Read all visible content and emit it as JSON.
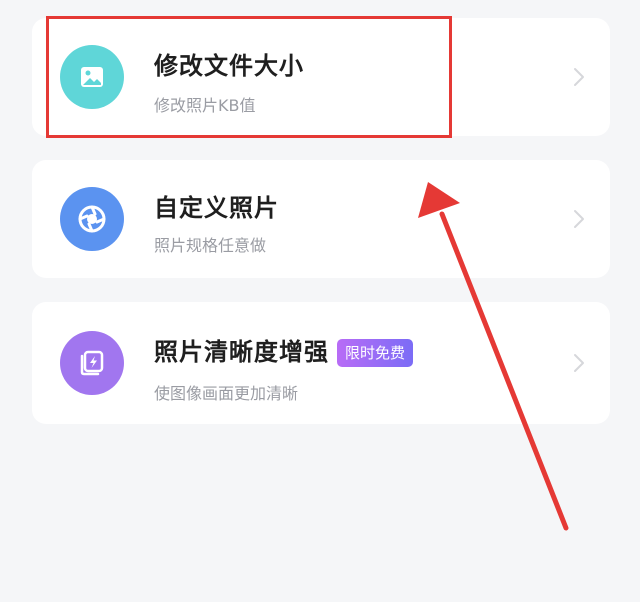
{
  "menu": {
    "items": [
      {
        "title": "修改文件大小",
        "subtitle": "修改照片KB值",
        "icon": "image-icon",
        "icon_color": "#5fd6d8"
      },
      {
        "title": "自定义照片",
        "subtitle": "照片规格任意做",
        "icon": "aperture-icon",
        "icon_color": "#5b93f0"
      },
      {
        "title": "照片清晰度增强",
        "badge": "限时免费",
        "subtitle": "使图像画面更加清晰",
        "icon": "enhance-icon",
        "icon_color": "#a176ef"
      }
    ]
  },
  "annotation": {
    "highlight_color": "#e53935",
    "arrow_color": "#e53935"
  },
  "colors": {
    "badge_start": "#b86cf6",
    "badge_end": "#7b6cf6"
  }
}
